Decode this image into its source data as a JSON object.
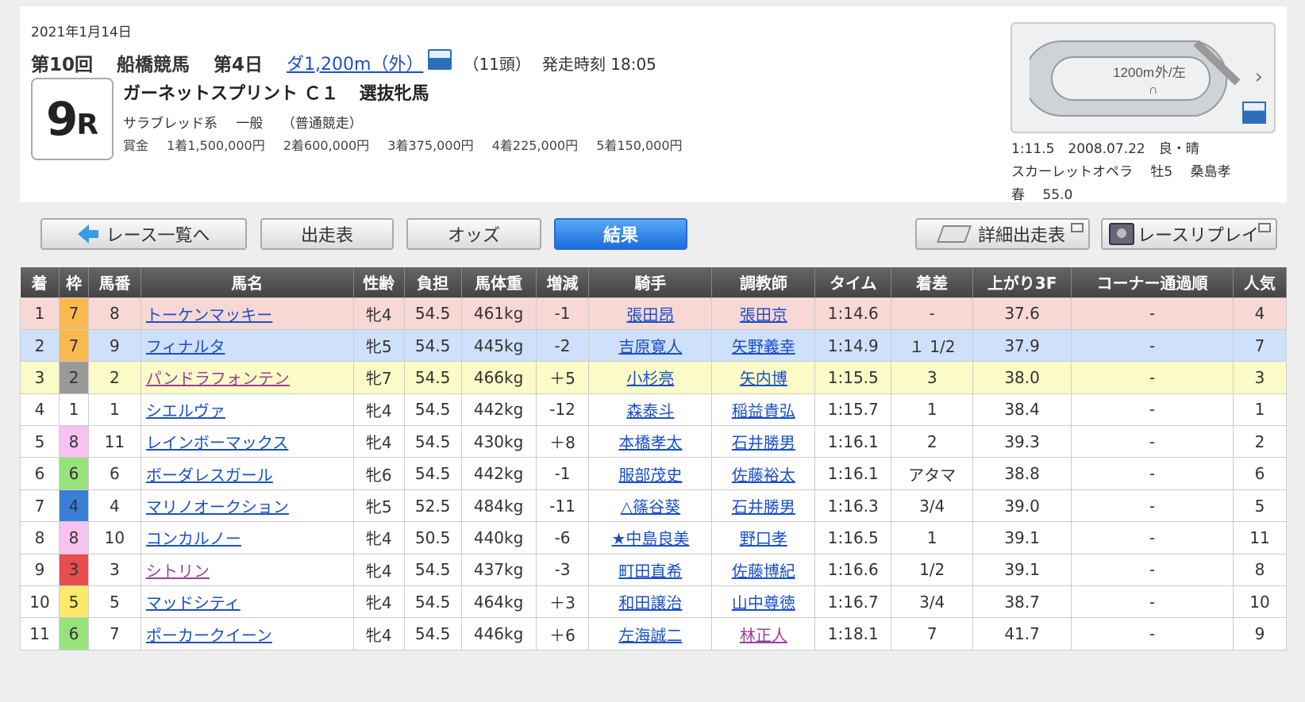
{
  "race": {
    "date": "2021年1月14日",
    "kai": "第10回",
    "venue": "船橋競馬",
    "day": "第4日",
    "distance": "ダ1,200m（外）",
    "heads": "（11頭）",
    "start_time": "発走時刻 18:05",
    "race_no": "9",
    "race_r": "R",
    "name": "ガーネットスプリント Ｃ１",
    "sub": "選抜牝馬",
    "breed": "サラブレッド系",
    "category": "一般",
    "condition": "（普通競走）",
    "prize_label": "賞金",
    "prizes": [
      "1着1,500,000円",
      "2着600,000円",
      "3着375,000円",
      "4着225,000円",
      "5着150,000円"
    ]
  },
  "course": {
    "label_dist": "1200m",
    "label_side": "外/左",
    "label_mark": "∩",
    "arrow": "›",
    "record_line1": "1:11.5　2008.07.22　良・晴",
    "record_line2": "スカーレットオペラ　 牡5　 桑島孝",
    "record_line3": "春　 55.0"
  },
  "nav": {
    "back": "レース一覧へ",
    "entries": "出走表",
    "odds": "オッズ",
    "results": "結果",
    "detail": "詳細出走表",
    "replay": "レースリプレイ"
  },
  "table": {
    "headers": [
      "着",
      "枠",
      "馬番",
      "馬名",
      "性齢",
      "負担",
      "馬体重",
      "増減",
      "騎手",
      "調教師",
      "タイム",
      "着差",
      "上がり3F",
      "コーナー通過順",
      "人気"
    ],
    "rows": [
      {
        "pos": "1",
        "waku": "7",
        "num": "8",
        "name": "トーケンマッキー",
        "sexage": "牝4",
        "weight": "54.5",
        "body": "461kg",
        "diff": "-1",
        "jockey": "張田昂",
        "trainer": "張田京",
        "time": "1:14.6",
        "margin": "-",
        "last3f": "37.6",
        "corner": "-",
        "pop": "4"
      },
      {
        "pos": "2",
        "waku": "7",
        "num": "9",
        "name": "フィナルタ",
        "sexage": "牝5",
        "weight": "54.5",
        "body": "445kg",
        "diff": "-2",
        "jockey": "吉原寛人",
        "trainer": "矢野義幸",
        "time": "1:14.9",
        "margin": "１ 1/2",
        "last3f": "37.9",
        "corner": "-",
        "pop": "7"
      },
      {
        "pos": "3",
        "waku": "2",
        "num": "2",
        "name": "パンドラフォンテン",
        "sexage": "牝7",
        "weight": "54.5",
        "body": "466kg",
        "diff": "＋5",
        "jockey": "小杉亮",
        "trainer": "矢内博",
        "time": "1:15.5",
        "margin": "3",
        "last3f": "38.0",
        "corner": "-",
        "pop": "3"
      },
      {
        "pos": "4",
        "waku": "1",
        "num": "1",
        "name": "シエルヴァ",
        "sexage": "牝4",
        "weight": "54.5",
        "body": "442kg",
        "diff": "-12",
        "jockey": "森泰斗",
        "trainer": "稲益貴弘",
        "time": "1:15.7",
        "margin": "1",
        "last3f": "38.4",
        "corner": "-",
        "pop": "1"
      },
      {
        "pos": "5",
        "waku": "8",
        "num": "11",
        "name": "レインボーマックス",
        "sexage": "牝4",
        "weight": "54.5",
        "body": "430kg",
        "diff": "＋8",
        "jockey": "本橋孝太",
        "trainer": "石井勝男",
        "time": "1:16.1",
        "margin": "2",
        "last3f": "39.3",
        "corner": "-",
        "pop": "2"
      },
      {
        "pos": "6",
        "waku": "6",
        "num": "6",
        "name": "ボーダレスガール",
        "sexage": "牝6",
        "weight": "54.5",
        "body": "442kg",
        "diff": "-1",
        "jockey": "服部茂史",
        "trainer": "佐藤裕太",
        "time": "1:16.1",
        "margin": "アタマ",
        "last3f": "38.8",
        "corner": "-",
        "pop": "6"
      },
      {
        "pos": "7",
        "waku": "4",
        "num": "4",
        "name": "マリノオークション",
        "sexage": "牝5",
        "weight": "52.5",
        "body": "484kg",
        "diff": "-11",
        "jockey": "△篠谷葵",
        "trainer": "石井勝男",
        "time": "1:16.3",
        "margin": "3/4",
        "last3f": "39.0",
        "corner": "-",
        "pop": "5"
      },
      {
        "pos": "8",
        "waku": "8",
        "num": "10",
        "name": "コンカルノー",
        "sexage": "牝4",
        "weight": "50.5",
        "body": "440kg",
        "diff": "-6",
        "jockey": "★中島良美",
        "trainer": "野口孝",
        "time": "1:16.5",
        "margin": "1",
        "last3f": "39.1",
        "corner": "-",
        "pop": "11"
      },
      {
        "pos": "9",
        "waku": "3",
        "num": "3",
        "name": "シトリン",
        "sexage": "牝4",
        "weight": "54.5",
        "body": "437kg",
        "diff": "-3",
        "jockey": "町田直希",
        "trainer": "佐藤博紀",
        "time": "1:16.6",
        "margin": "1/2",
        "last3f": "39.1",
        "corner": "-",
        "pop": "8"
      },
      {
        "pos": "10",
        "waku": "5",
        "num": "5",
        "name": "マッドシティ",
        "sexage": "牝4",
        "weight": "54.5",
        "body": "464kg",
        "diff": "＋3",
        "jockey": "和田譲治",
        "trainer": "山中尊徳",
        "time": "1:16.7",
        "margin": "3/4",
        "last3f": "38.7",
        "corner": "-",
        "pop": "10"
      },
      {
        "pos": "11",
        "waku": "6",
        "num": "7",
        "name": "ポーカークイーン",
        "sexage": "牝4",
        "weight": "54.5",
        "body": "446kg",
        "diff": "＋6",
        "jockey": "左海誠二",
        "trainer": "林正人",
        "time": "1:18.1",
        "margin": "7",
        "last3f": "41.7",
        "corner": "-",
        "pop": "9"
      }
    ]
  },
  "colors": {
    "link": "#1a4fc9",
    "visited_link": "#9a3f9a",
    "active_tab": "#1a6ee0",
    "row1": "#f8d8d4",
    "row2": "#cfe0fb",
    "row3": "#fafbc6"
  }
}
